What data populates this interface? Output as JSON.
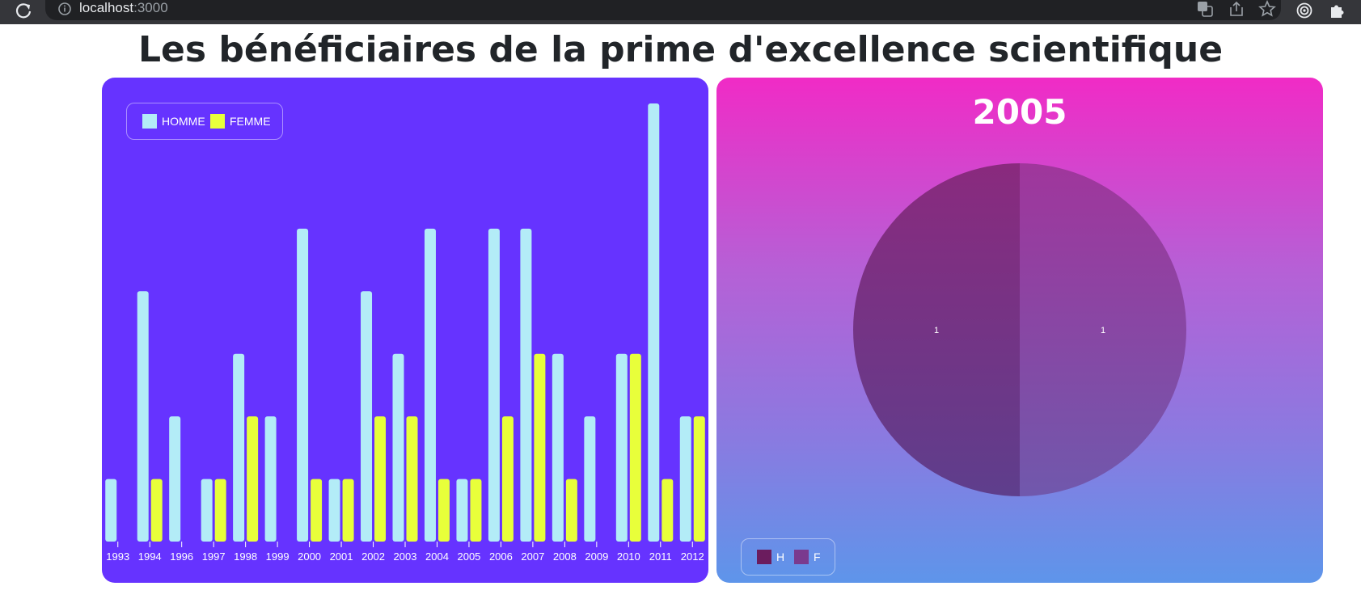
{
  "browser": {
    "url_host": "localhost",
    "url_port": ":3000",
    "icons": [
      "reload-icon",
      "info-icon",
      "translate-icon",
      "share-icon",
      "bookmark-star-icon",
      "extension-target-icon",
      "puzzle-extensions-icon"
    ]
  },
  "page_title": "Les bénéficiaires de la prime d'excellence scientifique",
  "colors": {
    "left_panel_bg": "#6633ff",
    "right_panel_gradient": [
      "#f02bc6",
      "#5e95ea"
    ],
    "homme": "#b3ecf7",
    "femme": "#e8ff3a",
    "pie_h": "#6b1c5e",
    "pie_f": "#7a3a8e"
  },
  "chart_data": [
    {
      "type": "bar",
      "legend_position": "top-left",
      "legend": [
        "HOMME",
        "FEMME"
      ],
      "categories": [
        "1993",
        "1994",
        "1996",
        "1997",
        "1998",
        "1999",
        "2000",
        "2001",
        "2002",
        "2003",
        "2004",
        "2005",
        "2006",
        "2007",
        "2008",
        "2009",
        "2010",
        "2011",
        "2012"
      ],
      "series": [
        {
          "name": "HOMME",
          "values": [
            1,
            4,
            2,
            1,
            3,
            2,
            5,
            1,
            4,
            3,
            5,
            1,
            5,
            5,
            3,
            2,
            3,
            7,
            2
          ]
        },
        {
          "name": "FEMME",
          "values": [
            0,
            1,
            0,
            1,
            2,
            0,
            1,
            1,
            2,
            2,
            1,
            1,
            2,
            3,
            1,
            0,
            3,
            1,
            2
          ]
        }
      ],
      "ylim": [
        0,
        7
      ],
      "grid": false
    },
    {
      "type": "pie",
      "title": "2005",
      "legend_position": "bottom-left",
      "legend": [
        "H",
        "F"
      ],
      "slices": [
        {
          "name": "H",
          "value": 1
        },
        {
          "name": "F",
          "value": 1
        }
      ]
    }
  ]
}
